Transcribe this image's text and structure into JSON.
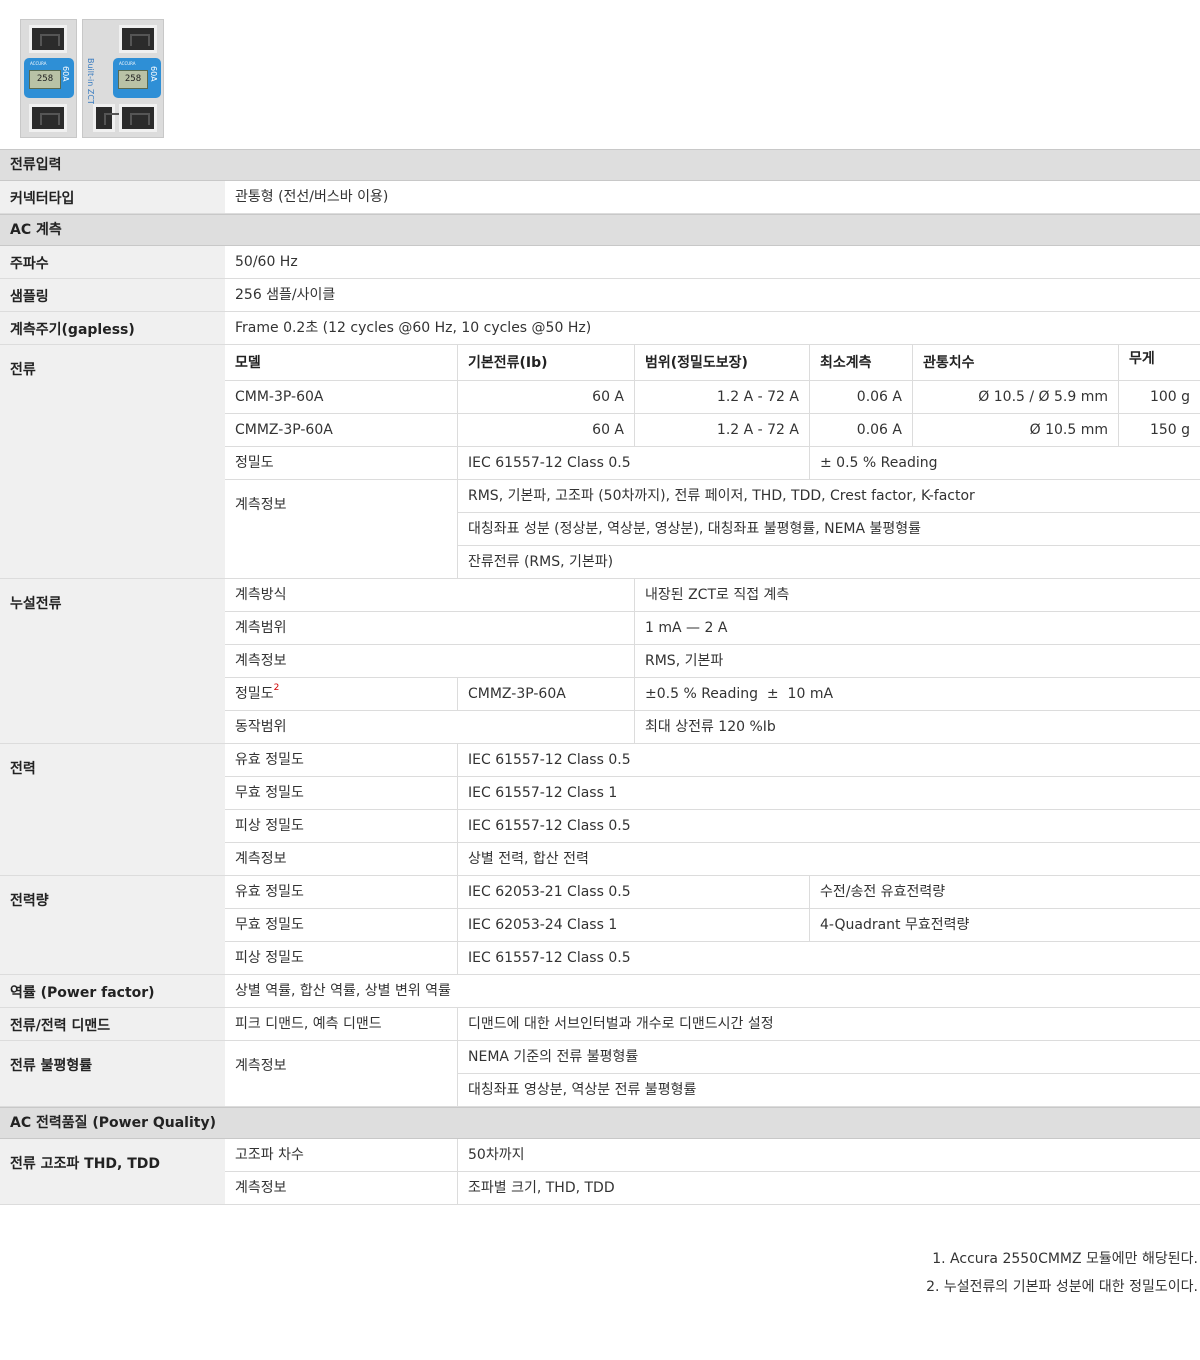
{
  "images": {
    "left": {
      "display": "258",
      "rating": "60A"
    },
    "right": {
      "side_text": "Built-in ZCT",
      "display": "258",
      "rating": "60A"
    }
  },
  "sections": {
    "current_input": "전류입력",
    "ac_measure": "AC 계측",
    "power_quality": "AC 전력품질 (Power Quality)"
  },
  "connector": {
    "label": "커넥터타입",
    "value": "관통형 (전선/버스바 이용)"
  },
  "frequency": {
    "label": "주파수",
    "value": "50/60 Hz"
  },
  "sampling": {
    "label": "샘플링",
    "value": "256 샘플/사이클"
  },
  "period": {
    "label": "계측주기(gapless)",
    "value": "Frame 0.2초 (12 cycles @60 Hz, 10 cycles @50 Hz)"
  },
  "current": {
    "label": "전류",
    "headers": [
      "모델",
      "기본전류(Ib)",
      "범위(정밀도보장)",
      "최소계측",
      "관통치수",
      "무게"
    ],
    "rows": [
      [
        "CMM-3P-60A",
        "60 A",
        "1.2 A - 72 A",
        "0.06 A",
        "Ø 10.5 / Ø 5.9 mm",
        "100 g"
      ],
      [
        "CMMZ-3P-60A",
        "60 A",
        "1.2 A - 72 A",
        "0.06 A",
        "Ø 10.5 mm",
        "150 g"
      ]
    ],
    "accuracy_label": "정밀도",
    "accuracy_class": "IEC 61557-12 Class 0.5",
    "accuracy_value": "± 0.5 % Reading",
    "info_label": "계측정보",
    "info": [
      "RMS, 기본파, 고조파 (50차까지), 전류 페이저, THD, TDD, Crest factor, K-factor",
      "대칭좌표 성분 (정상분, 역상분, 영상분), 대칭좌표 불평형률, NEMA 불평형률",
      "잔류전류 (RMS, 기본파)"
    ]
  },
  "leakage": {
    "label": "누설전류",
    "method_label": "계측방식",
    "method": "내장된 ZCT로 직접 계측",
    "range_label": "계측범위",
    "range": "1 mA — 2 A",
    "info_label": "계측정보",
    "info": "RMS, 기본파",
    "accuracy_label": "정밀도",
    "accuracy_sup": "2",
    "accuracy_model": "CMMZ-3P-60A",
    "accuracy": "±0.5 % Reading  ±  10 mA",
    "op_label": "동작범위",
    "op": "최대 상전류 120 %Ib"
  },
  "power": {
    "label": "전력",
    "rows": [
      [
        "유효 정밀도",
        "IEC 61557-12 Class 0.5"
      ],
      [
        "무효 정밀도",
        "IEC 61557-12 Class 1"
      ],
      [
        "피상 정밀도",
        "IEC 61557-12 Class 0.5"
      ],
      [
        "계측정보",
        "상별 전력, 합산 전력"
      ]
    ]
  },
  "energy": {
    "label": "전력량",
    "rows": [
      [
        "유효 정밀도",
        "IEC 62053-21 Class 0.5",
        "수전/송전 유효전력량"
      ],
      [
        "무효 정밀도",
        "IEC 62053-24 Class 1",
        "4-Quadrant 무효전력량"
      ],
      [
        "피상 정밀도",
        "IEC 61557-12 Class 0.5",
        ""
      ]
    ]
  },
  "pf": {
    "label": "역률 (Power factor)",
    "value": "상별 역률, 합산 역률, 상별 변위 역률"
  },
  "demand": {
    "label": "전류/전력 디맨드",
    "type": "피크 디맨드, 예측 디맨드",
    "desc": "디맨드에 대한 서브인터벌과 개수로 디맨드시간 설정"
  },
  "unbalance": {
    "label": "전류 불평형률",
    "sub_label": "계측정보",
    "lines": [
      "NEMA 기준의 전류 불평형률",
      "대칭좌표 영상분, 역상분 전류 불평형률"
    ]
  },
  "thd": {
    "label": "전류 고조파 THD, TDD",
    "order_label": "고조파 차수",
    "order": "50차까지",
    "info_label": "계측정보",
    "info": "조파별 크기, THD, TDD"
  },
  "footnotes": [
    "1. Accura 2550CMMZ 모듈에만 해당된다.",
    "2. 누설전류의 기본파 성분에 대한 정밀도이다."
  ]
}
